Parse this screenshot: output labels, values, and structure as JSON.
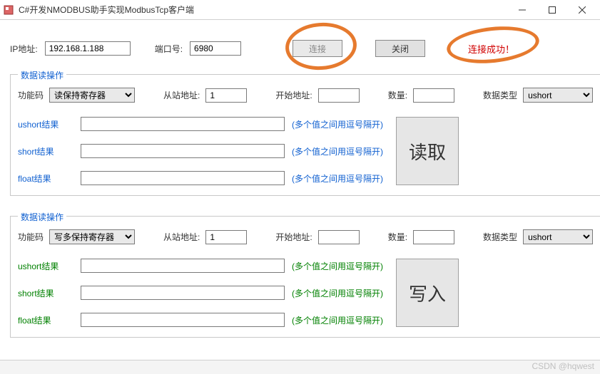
{
  "window": {
    "title": "C#开发NMODBUS助手实现ModbusTcp客户端"
  },
  "conn": {
    "ip_label": "IP地址:",
    "ip_value": "192.168.1.188",
    "port_label": "端口号:",
    "port_value": "6980",
    "connect_btn": "连接",
    "close_btn": "关闭",
    "status": "连接成功！"
  },
  "read": {
    "group_title": "数据读操作",
    "func_label": "功能码",
    "func_value": "读保持寄存器",
    "slave_label": "从站地址:",
    "slave_value": "1",
    "start_label": "开始地址:",
    "start_value": "",
    "qty_label": "数量:",
    "qty_value": "",
    "dtype_label": "数据类型",
    "dtype_value": "ushort",
    "labels": {
      "ushort": "ushort结果",
      "short": "short结果",
      "float": "float结果"
    },
    "hint": "(多个值之间用逗号隔开)",
    "action": "读取"
  },
  "write": {
    "group_title": "数据读操作",
    "func_label": "功能码",
    "func_value": "写多保持寄存器",
    "slave_label": "从站地址:",
    "slave_value": "1",
    "start_label": "开始地址:",
    "start_value": "",
    "qty_label": "数量:",
    "qty_value": "",
    "dtype_label": "数据类型",
    "dtype_value": "ushort",
    "labels": {
      "ushort": "ushort结果",
      "short": "short结果",
      "float": "float结果"
    },
    "hint": "(多个值之间用逗号隔开)",
    "action": "写入"
  },
  "watermark": "CSDN @hqwest"
}
